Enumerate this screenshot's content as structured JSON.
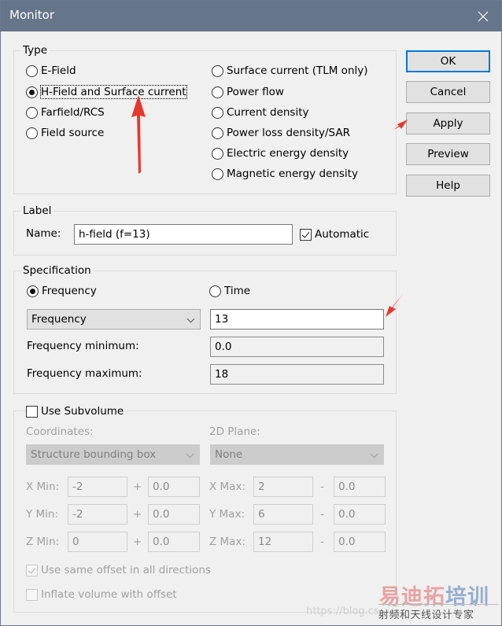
{
  "window": {
    "title": "Monitor",
    "close_icon": "close-x-icon"
  },
  "type_group": {
    "legend": "Type",
    "options_left": [
      {
        "label": "E-Field",
        "selected": false
      },
      {
        "label": "H-Field and Surface current",
        "selected": true
      },
      {
        "label": "Farfield/RCS",
        "selected": false
      },
      {
        "label": "Field source",
        "selected": false
      }
    ],
    "options_right": [
      {
        "label": "Surface current (TLM only)",
        "selected": false
      },
      {
        "label": "Power flow",
        "selected": false
      },
      {
        "label": "Current density",
        "selected": false
      },
      {
        "label": "Power loss density/SAR",
        "selected": false
      },
      {
        "label": "Electric energy density",
        "selected": false
      },
      {
        "label": "Magnetic energy density",
        "selected": false
      }
    ]
  },
  "buttons": {
    "ok": "OK",
    "cancel": "Cancel",
    "apply": "Apply",
    "preview": "Preview",
    "help": "Help"
  },
  "label_group": {
    "legend": "Label",
    "name_label": "Name:",
    "name_value": "h-field (f=13)",
    "automatic_label": "Automatic",
    "automatic_checked": true
  },
  "specification_group": {
    "legend": "Specification",
    "frequency_radio": "Frequency",
    "frequency_selected": true,
    "time_radio": "Time",
    "time_selected": false,
    "mode_select_value": "Frequency",
    "frequency_value": "13",
    "freq_min_label": "Frequency minimum:",
    "freq_min_value": "0.0",
    "freq_max_label": "Frequency maximum:",
    "freq_max_value": "18"
  },
  "subvolume_group": {
    "use_subvolume_label": "Use Subvolume",
    "use_subvolume_checked": false,
    "coordinates_label": "Coordinates:",
    "coordinates_value": "Structure bounding box",
    "plane_label": "2D Plane:",
    "plane_value": "None",
    "rows": [
      {
        "min_label": "X Min:",
        "min": "-2",
        "min_offset": "0.0",
        "plus": "+",
        "max_label": "X Max:",
        "max": "2",
        "max_offset": "0.0",
        "minus": "-"
      },
      {
        "min_label": "Y Min:",
        "min": "-2",
        "min_offset": "0.0",
        "plus": "+",
        "max_label": "Y Max:",
        "max": "6",
        "max_offset": "0.0",
        "minus": "-"
      },
      {
        "min_label": "Z Min:",
        "min": "0",
        "min_offset": "0.0",
        "plus": "+",
        "max_label": "Z Max:",
        "max": "12",
        "max_offset": "0.0",
        "minus": "-"
      }
    ],
    "same_offset_label": "Use same offset in all directions",
    "same_offset_checked": true,
    "inflate_label": "Inflate volume with offset",
    "inflate_checked": false
  },
  "annotations": {
    "arrow_color": "#e8372c"
  },
  "watermark": {
    "brand_red": "易迪拓",
    "brand_blue": "培训",
    "tagline": "射频和天线设计专家",
    "url": "https://blog.cs"
  }
}
